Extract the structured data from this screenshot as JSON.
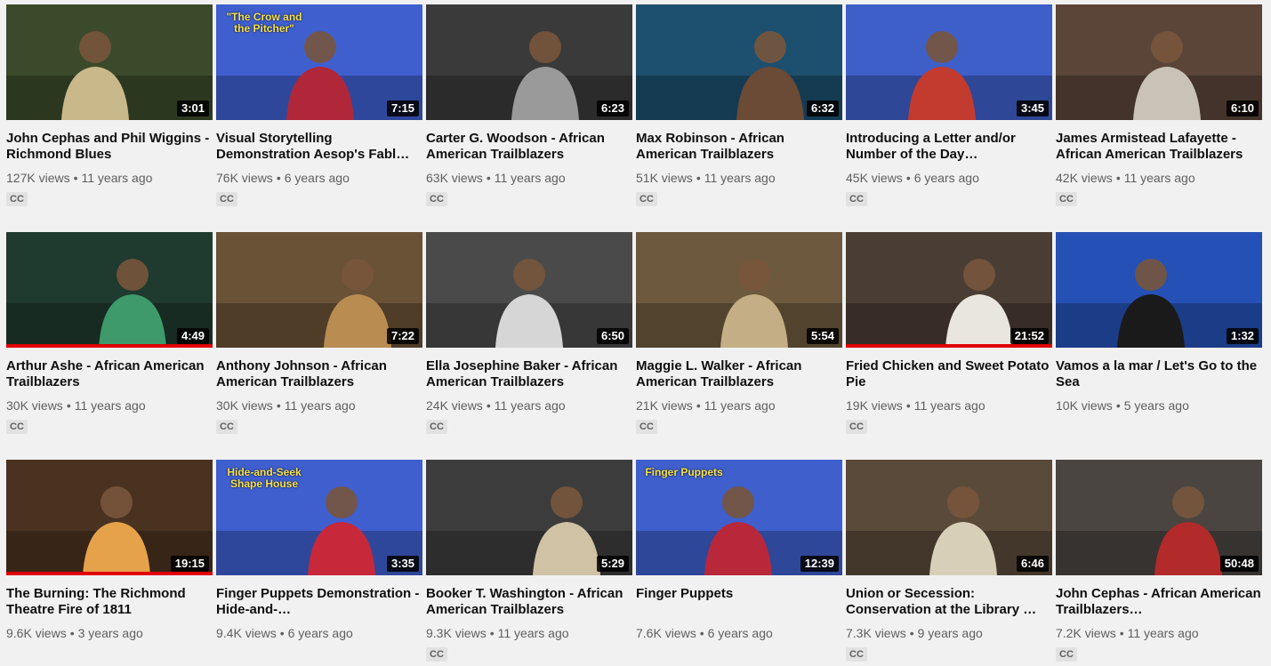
{
  "videos": [
    {
      "title": "John Cephas and Phil Wiggins - Richmond Blues",
      "duration": "3:01",
      "views": "127K views",
      "age": "11 years ago",
      "badge": "CC",
      "bg": "#3b4a2a",
      "accent": "#c9b88a"
    },
    {
      "title": "Visual Storytelling Demonstration Aesop's Fabl…",
      "duration": "7:15",
      "views": "76K views",
      "age": "6 years ago",
      "badge": "CC",
      "bg": "#3f5fcf",
      "accent": "#b0273a",
      "overlay": "\"The Crow and the Pitcher\""
    },
    {
      "title": "Carter G. Woodson - African American Trailblazers",
      "duration": "6:23",
      "views": "63K views",
      "age": "11 years ago",
      "badge": "CC",
      "bg": "#3a3a3a",
      "accent": "#9a9a9a"
    },
    {
      "title": "Max Robinson - African American Trailblazers",
      "duration": "6:32",
      "views": "51K views",
      "age": "11 years ago",
      "badge": "CC",
      "bg": "#1d4f6e",
      "accent": "#6b4a36"
    },
    {
      "title": "Introducing a Letter and/or Number of the Day…",
      "duration": "3:45",
      "views": "45K views",
      "age": "6 years ago",
      "badge": "CC",
      "bg": "#3e5fc8",
      "accent": "#c33b2e"
    },
    {
      "title": "James Armistead Lafayette - African American Trailblazers",
      "duration": "6:10",
      "views": "42K views",
      "age": "11 years ago",
      "badge": "CC",
      "bg": "#5a4538",
      "accent": "#c9c2b6"
    },
    {
      "title": "Arthur Ashe - African American Trailblazers",
      "duration": "4:49",
      "views": "30K views",
      "age": "11 years ago",
      "badge": "CC",
      "bg": "#1f3a2e",
      "accent": "#3e9a6a",
      "progress": 1.0
    },
    {
      "title": "Anthony Johnson - African American Trailblazers",
      "duration": "7:22",
      "views": "30K views",
      "age": "11 years ago",
      "badge": "CC",
      "bg": "#6a5236",
      "accent": "#b98c52"
    },
    {
      "title": "Ella Josephine Baker - African American Trailblazers",
      "duration": "6:50",
      "views": "24K views",
      "age": "11 years ago",
      "badge": "CC",
      "bg": "#4a4a4a",
      "accent": "#d6d6d6"
    },
    {
      "title": "Maggie L. Walker - African American Trailblazers",
      "duration": "5:54",
      "views": "21K views",
      "age": "11 years ago",
      "badge": "CC",
      "bg": "#6d5a3e",
      "accent": "#c4ae85"
    },
    {
      "title": "Fried Chicken and Sweet Potato Pie",
      "duration": "21:52",
      "views": "19K views",
      "age": "11 years ago",
      "badge": "CC",
      "bg": "#4a3d33",
      "accent": "#e9e5df",
      "progress": 1.0
    },
    {
      "title": "Vamos a la mar / Let's Go to the Sea",
      "duration": "1:32",
      "views": "10K views",
      "age": "5 years ago",
      "badge": "",
      "bg": "#2550b5",
      "accent": "#1a1a1a"
    },
    {
      "title": "The Burning: The Richmond Theatre Fire of 1811",
      "duration": "19:15",
      "views": "9.6K views",
      "age": "3 years ago",
      "badge": "",
      "bg": "#4a3220",
      "accent": "#e6a24a",
      "progress": 1.0
    },
    {
      "title": "Finger Puppets Demonstration - Hide-and-…",
      "duration": "3:35",
      "views": "9.4K views",
      "age": "6 years ago",
      "badge": "",
      "bg": "#3f5fcf",
      "accent": "#c7283a",
      "overlay": "Hide-and-Seek Shape House"
    },
    {
      "title": "Booker T. Washington - African American Trailblazers",
      "duration": "5:29",
      "views": "9.3K views",
      "age": "11 years ago",
      "badge": "CC",
      "bg": "#3c3c3c",
      "accent": "#cfc2a5"
    },
    {
      "title": "Finger Puppets",
      "duration": "12:39",
      "views": "7.6K views",
      "age": "6 years ago",
      "badge": "",
      "bg": "#3e5fcc",
      "accent": "#b8283a",
      "overlay": "Finger Puppets"
    },
    {
      "title": "Union or Secession: Conservation at the Library …",
      "duration": "6:46",
      "views": "7.3K views",
      "age": "9 years ago",
      "badge": "CC",
      "bg": "#5a4a3a",
      "accent": "#d8cfb8"
    },
    {
      "title": "John Cephas - African American Trailblazers…",
      "duration": "50:48",
      "views": "7.2K views",
      "age": "11 years ago",
      "badge": "CC",
      "bg": "#4a4540",
      "accent": "#b22a2a"
    }
  ]
}
